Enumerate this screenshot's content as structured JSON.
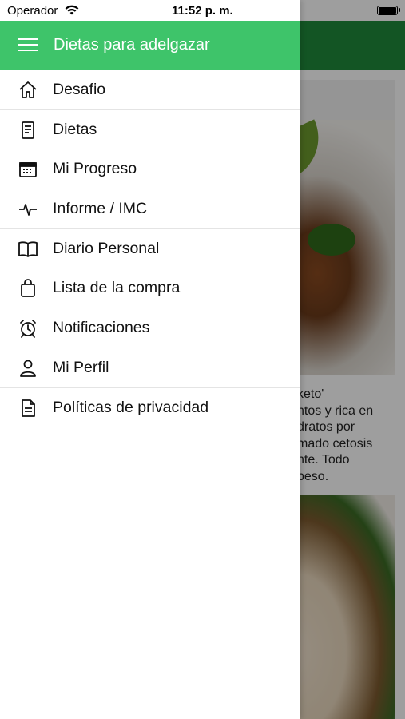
{
  "status_bar": {
    "carrier": "Operador",
    "time": "11:52 p. m."
  },
  "drawer": {
    "title": "Dietas para adelgazar",
    "items": [
      {
        "label": "Desafio",
        "icon": "home-icon"
      },
      {
        "label": "Dietas",
        "icon": "document-icon"
      },
      {
        "label": "Mi Progreso",
        "icon": "calendar-icon"
      },
      {
        "label": "Informe / IMC",
        "icon": "pulse-icon"
      },
      {
        "label": "Diario Personal",
        "icon": "book-icon"
      },
      {
        "label": "Lista de la compra",
        "icon": "shopping-bag-icon"
      },
      {
        "label": "Notificaciones",
        "icon": "alarm-clock-icon"
      },
      {
        "label": "Mi Perfil",
        "icon": "person-icon"
      },
      {
        "label": "Políticas de privacidad",
        "icon": "file-text-icon"
      }
    ]
  },
  "background": {
    "card_text": "keto'\nntos y rica en\ndratos por\nmado cetosis\nnte. Todo\npeso."
  },
  "colors": {
    "drawer_header": "#3ec46a",
    "app_header": "#1f8a3a"
  }
}
